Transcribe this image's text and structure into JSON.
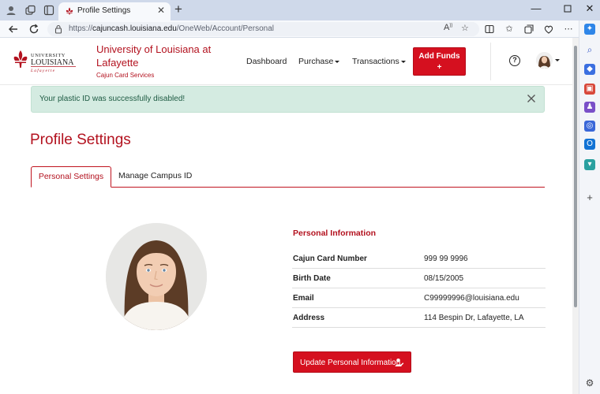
{
  "browser": {
    "tab_title": "Profile Settings",
    "url_prefix": "https://",
    "url_host": "cajuncash.louisiana.edu",
    "url_path": "/OneWeb/Account/Personal"
  },
  "header": {
    "brand_line1": "University of Louisiana at",
    "brand_line2": "Lafayette",
    "brand_sub": "Cajun Card Services",
    "nav": {
      "dashboard": "Dashboard",
      "purchase": "Purchase",
      "transactions": "Transactions"
    },
    "add_funds_label": "Add Funds",
    "add_funds_plus": "+",
    "help_glyph": "?"
  },
  "alert": {
    "message": "Your plastic ID was successfully disabled!"
  },
  "page": {
    "title": "Profile Settings",
    "tabs": [
      "Personal Settings",
      "Manage Campus ID"
    ]
  },
  "personal": {
    "heading": "Personal Information",
    "rows": [
      {
        "label": "Cajun Card Number",
        "value": "999 99 9996"
      },
      {
        "label": "Birth Date",
        "value": "08/15/2005"
      },
      {
        "label": "Email",
        "value": "C99999996@louisiana.edu"
      },
      {
        "label": "Address",
        "value": "114 Bespin Dr, Lafayette, LA"
      }
    ],
    "update_button": "Update Personal Information"
  },
  "icons": {
    "back": "arrow-left-icon",
    "reload": "reload-icon",
    "help": "question-circle-icon",
    "alert_close": "close-icon",
    "update": "user-edit-icon"
  },
  "colors": {
    "brand_red": "#b3121f",
    "button_red": "#d5101f",
    "alert_bg": "#d4ebe1",
    "alert_text": "#1e5b43"
  }
}
